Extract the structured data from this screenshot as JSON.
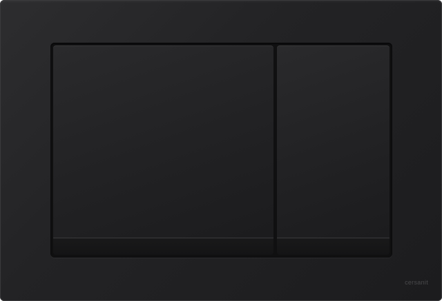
{
  "product": {
    "brand_logo": "cersanit",
    "colors": {
      "plate": "#232325",
      "button": "#222224",
      "recess": "#101011",
      "logo_text": "#4a4a4c"
    }
  }
}
